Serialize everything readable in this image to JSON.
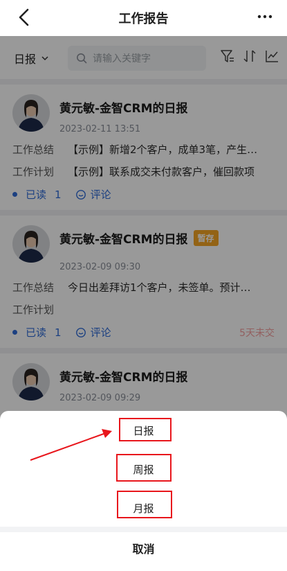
{
  "navbar": {
    "title": "工作报告",
    "back_icon": "chevron-left-icon",
    "more_icon": "more-dots-icon"
  },
  "filter": {
    "type_label": "日报",
    "search_placeholder": "请输入关键字",
    "icons": [
      "filter-icon",
      "sort-icon",
      "chart-icon"
    ]
  },
  "reports": [
    {
      "title": "黄元敏-金智CRM的日报",
      "badge": "",
      "time": "2023-02-11 13:51",
      "summary_label": "工作总结",
      "summary": "【示例】新增2个客户，成单3笔，产生…",
      "plan_label": "工作计划",
      "plan": "【示例】联系成交未付款客户，催回款项",
      "read_label": "已读",
      "read_count": "1",
      "comment_label": "评论",
      "status": ""
    },
    {
      "title": "黄元敏-金智CRM的日报",
      "badge": "暂存",
      "time": "2023-02-09 09:30",
      "summary_label": "工作总结",
      "summary": "今日出差拜访1个客户，未签单。预计…",
      "plan_label": "工作计划",
      "plan": "",
      "read_label": "已读",
      "read_count": "1",
      "comment_label": "评论",
      "status": "5天未交"
    },
    {
      "title": "黄元敏-金智CRM的日报",
      "badge": "",
      "time": "2023-02-09 09:29"
    }
  ],
  "action_sheet": {
    "options": [
      "日报",
      "周报",
      "月报"
    ],
    "cancel": "取消"
  },
  "colors": {
    "accent": "#2f6cd8",
    "badge": "#f5a623",
    "overdue": "#f4a0a0",
    "annotation": "#e8161c"
  }
}
